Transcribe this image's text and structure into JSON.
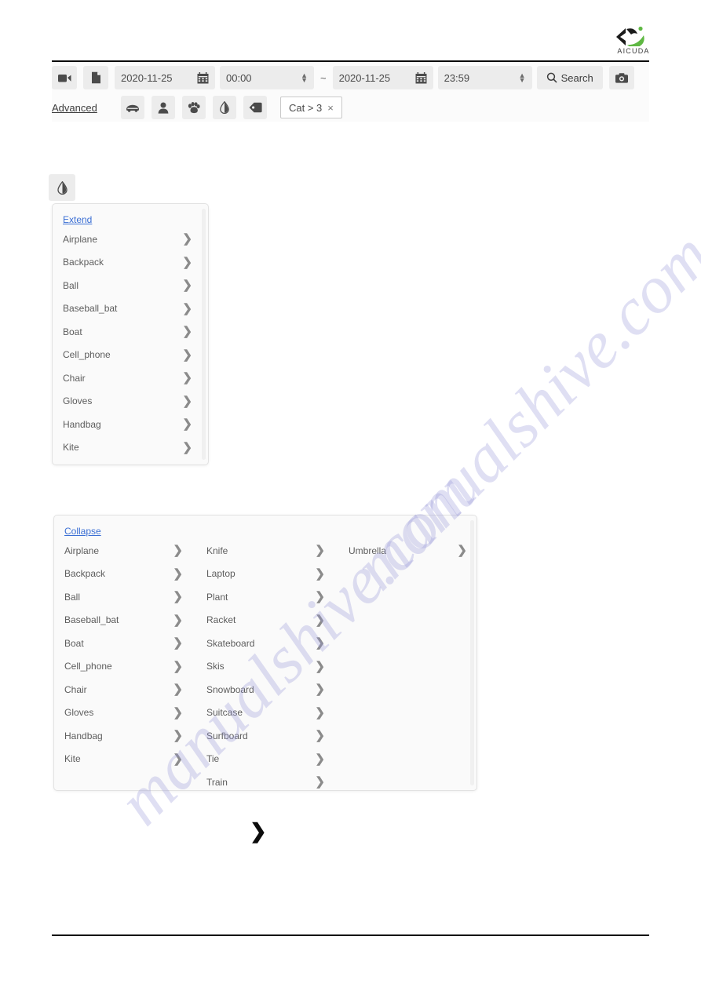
{
  "brand": {
    "name": "AICUDA",
    "logo_icon": "aicuda-logo-icon"
  },
  "toolbar": {
    "video_button_icon": "video-camera-icon",
    "file_button_icon": "document-file-icon",
    "start_date": "2020-11-25",
    "start_time": "00:00",
    "range_separator": "~",
    "end_date": "2020-11-25",
    "end_time": "23:59",
    "calendar_icon": "calendar-icon",
    "spinner_up_icon": "chevron-up-icon",
    "spinner_down_icon": "chevron-down-icon",
    "search_label": "Search",
    "search_icon": "magnifier-icon",
    "snapshot_button_icon": "camera-icon"
  },
  "advanced": {
    "label": "Advanced",
    "filters": [
      {
        "name": "vehicle-filter",
        "icon": "car-icon"
      },
      {
        "name": "person-filter",
        "icon": "person-icon"
      },
      {
        "name": "animal-filter",
        "icon": "paw-icon"
      },
      {
        "name": "object-filter",
        "icon": "water-drop-icon"
      },
      {
        "name": "tag-filter",
        "icon": "tag-icon"
      }
    ],
    "chip": {
      "label": "Cat > 3",
      "remove_icon": "×"
    }
  },
  "drop_trigger": {
    "icon": "water-drop-icon"
  },
  "panel_collapsed": {
    "toggle_label": "Extend",
    "chevron_icon": "chevron-right-icon",
    "columns": [
      [
        "Airplane",
        "Backpack",
        "Ball",
        "Baseball_bat",
        "Boat",
        "Cell_phone",
        "Chair",
        "Gloves",
        "Handbag",
        "Kite"
      ]
    ]
  },
  "panel_expanded": {
    "toggle_label": "Collapse",
    "chevron_icon": "chevron-right-icon",
    "columns": [
      [
        "Airplane",
        "Backpack",
        "Ball",
        "Baseball_bat",
        "Boat",
        "Cell_phone",
        "Chair",
        "Gloves",
        "Handbag",
        "Kite"
      ],
      [
        "Knife",
        "Laptop",
        "Plant",
        "Racket",
        "Skateboard",
        "Skis",
        "Snowboard",
        "Suitcase",
        "Surfboard",
        "Tie",
        "Train"
      ],
      [
        "Umbrella"
      ]
    ]
  },
  "standalone_chevron": {
    "icon": "chevron-right-icon"
  },
  "watermark": {
    "line1": "manualshive.com",
    "line2": "manualshive.com"
  },
  "colors": {
    "link": "#3b6fd4",
    "button_bg": "#ececec",
    "panel_bg": "#fafafa",
    "text": "#5d5d5d"
  }
}
